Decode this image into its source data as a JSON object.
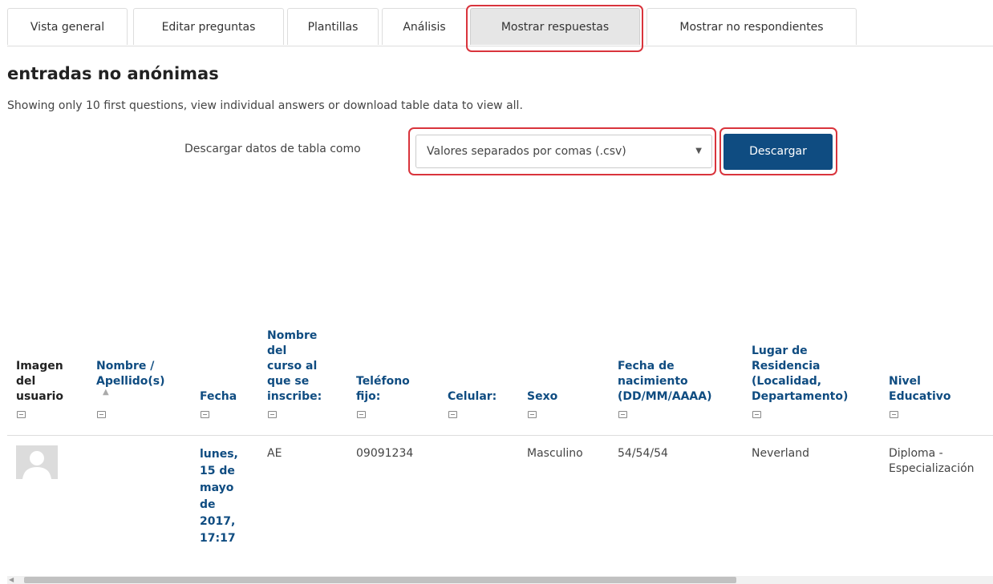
{
  "tabs": [
    {
      "label": "Vista general"
    },
    {
      "label": "Editar preguntas"
    },
    {
      "label": "Plantillas"
    },
    {
      "label": "Análisis"
    },
    {
      "label": "Mostrar respuestas",
      "active": true
    },
    {
      "label": "Mostrar no respondientes"
    }
  ],
  "page": {
    "title": "entradas no anónimas",
    "note": "Showing only 10 first questions, view individual answers or download table data to view all."
  },
  "download": {
    "label": "Descargar datos de tabla como",
    "format_selected": "Valores separados por comas (.csv)",
    "button_label": "Descargar"
  },
  "table": {
    "columns": [
      {
        "label_lines": [
          "Imagen",
          "del",
          "usuario"
        ]
      },
      {
        "label_lines": [
          "Nombre /",
          "Apellido(s)"
        ]
      },
      {
        "label_lines": [
          "Fecha"
        ]
      },
      {
        "label_lines": [
          "Nombre",
          "del",
          "curso al",
          "que se",
          "inscribe:"
        ]
      },
      {
        "label_lines": [
          "Teléfono",
          "fijo:"
        ]
      },
      {
        "label_lines": [
          "Celular:"
        ]
      },
      {
        "label_lines": [
          "Sexo"
        ]
      },
      {
        "label_lines": [
          "Fecha de",
          "nacimiento",
          "(DD/MM/AAAA)"
        ]
      },
      {
        "label_lines": [
          "Lugar de",
          "Residencia",
          "(Localidad,",
          "Departamento)"
        ]
      },
      {
        "label_lines": [
          "Nivel",
          "Educativo"
        ]
      }
    ],
    "rows": [
      {
        "fecha_lines": [
          "lunes,",
          "15 de",
          "mayo",
          "de",
          "2017,",
          "17:17"
        ],
        "curso": "AE",
        "telefono": "09091234",
        "celular": "",
        "sexo": "Masculino",
        "nacimiento": "54/54/54",
        "residencia": "Neverland",
        "nivel_lines": [
          "Diploma -",
          "Especialización"
        ]
      }
    ]
  },
  "colors": {
    "accent": "#0f4c81",
    "highlight": "#d9343c",
    "active_tab": "#e6e6e6"
  }
}
